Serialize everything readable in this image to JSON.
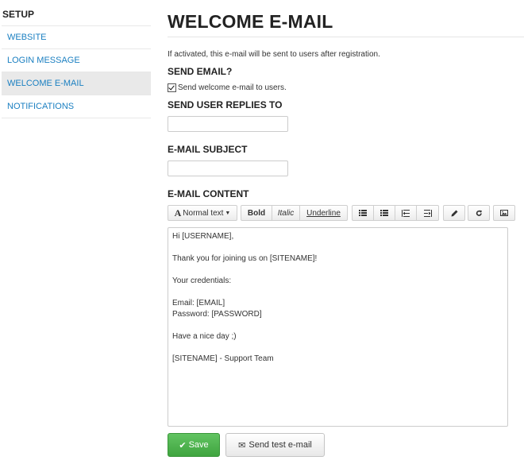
{
  "sidebar": {
    "title": "SETUP",
    "items": [
      {
        "label": "WEBSITE"
      },
      {
        "label": "LOGIN MESSAGE"
      },
      {
        "label": "WELCOME E-MAIL"
      },
      {
        "label": "NOTIFICATIONS"
      }
    ],
    "active_index": 2
  },
  "main": {
    "title": "WELCOME E-MAIL",
    "description": "If activated, this e-mail will be sent to users after registration.",
    "send_email": {
      "label": "SEND EMAIL?",
      "checkbox_label": "Send welcome e-mail to users.",
      "checked": true
    },
    "reply_to": {
      "label": "SEND USER REPLIES TO",
      "value": ""
    },
    "subject": {
      "label": "E-MAIL SUBJECT",
      "value": ""
    },
    "content": {
      "label": "E-MAIL CONTENT",
      "toolbar": {
        "format_label": "Normal text",
        "bold_label": "Bold",
        "italic_label": "Italic",
        "underline_label": "Underline"
      },
      "lines": [
        "Hi [USERNAME],",
        "",
        "Thank you for joining us on [SITENAME]!",
        "",
        "Your credentials:",
        "",
        "Email: [EMAIL]",
        "Password: [PASSWORD]",
        "",
        "Have a nice day ;)",
        "",
        "[SITENAME] - Support Team"
      ]
    },
    "actions": {
      "save_label": "Save",
      "test_label": "Send test e-mail"
    }
  },
  "icons": {
    "format": "font-icon",
    "list_bullet": "list-ul-icon",
    "list_ordered": "list-ol-icon",
    "outdent": "outdent-icon",
    "indent": "indent-icon",
    "pencil": "pencil-icon",
    "redo": "redo-icon",
    "image": "image-icon",
    "check": "check-icon",
    "envelope": "envelope-icon"
  },
  "colors": {
    "link": "#1a7fc1",
    "save_green": "#4cae4c",
    "active_bg": "#e9e9e9"
  }
}
